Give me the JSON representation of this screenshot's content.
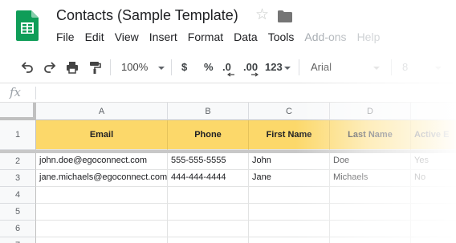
{
  "doc": {
    "title": "Contacts (Sample Template)",
    "star_icon": "star-outline-icon",
    "folder_icon": "folder-icon",
    "logo_color": "#0f9d58"
  },
  "menu": [
    "File",
    "Edit",
    "View",
    "Insert",
    "Format",
    "Data",
    "Tools",
    "Add-ons",
    "Help"
  ],
  "toolbar": {
    "zoom": "100%",
    "currency": "$",
    "percent": "%",
    "decrease_decimals": ".0",
    "increase_decimals": ".00",
    "more_formats": "123",
    "font": "Arial",
    "font_size": "8"
  },
  "formula_bar": {
    "icon": "fx",
    "value": ""
  },
  "sheet": {
    "columns": [
      "A",
      "B",
      "C",
      "D"
    ],
    "rows": [
      "1",
      "2",
      "3",
      "4",
      "5",
      "6",
      "7"
    ],
    "header_row": [
      "Email",
      "Phone",
      "First Name",
      "Last Name",
      "Active E"
    ],
    "data": [
      [
        "john.doe@egoconnect.com",
        "555-555-5555",
        "John",
        "Doe",
        "Yes"
      ],
      [
        "jane.michaels@egoconnect.com",
        "444-444-4444",
        "Jane",
        "Michaels",
        "No"
      ]
    ],
    "header_color": "#fcd86a"
  }
}
